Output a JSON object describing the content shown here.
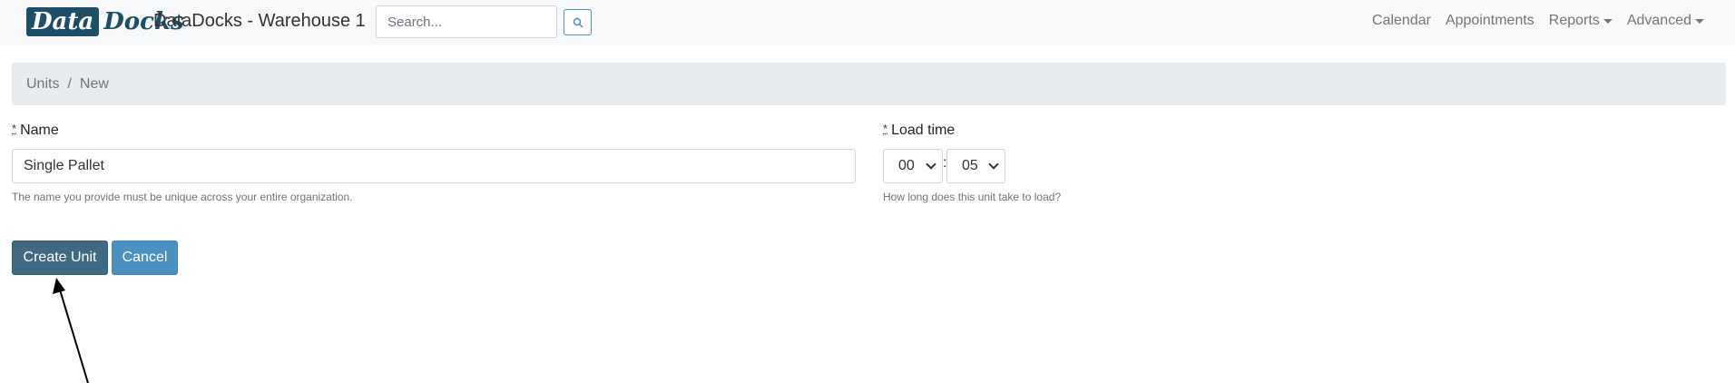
{
  "header": {
    "logo": {
      "part1": "Data",
      "part2": "Docks"
    },
    "title": "DataDocks - Warehouse 1",
    "search": {
      "placeholder": "Search...",
      "value": ""
    },
    "search_button_icon": "search-icon",
    "nav": [
      {
        "label": "Calendar",
        "dropdown": false
      },
      {
        "label": "Appointments",
        "dropdown": false
      },
      {
        "label": "Reports",
        "dropdown": true
      },
      {
        "label": "Advanced",
        "dropdown": true
      }
    ]
  },
  "breadcrumb": {
    "items": [
      "Units",
      "New"
    ],
    "separator": "/"
  },
  "form": {
    "name": {
      "required_marker": "*",
      "label": "Name",
      "value": "Single Pallet",
      "help": "The name you provide must be unique across your entire organization."
    },
    "load_time": {
      "required_marker": "*",
      "label": "Load time",
      "hours": "00",
      "separator": ":",
      "minutes": "05",
      "help": "How long does this unit take to load?"
    }
  },
  "actions": {
    "create_label": "Create Unit",
    "cancel_label": "Cancel"
  },
  "colors": {
    "brand": "#1d4e66",
    "create_button": "#3f6a82",
    "cancel_button": "#4a90c0",
    "navbar_bg": "#f8f9fa",
    "breadcrumb_bg": "#e9ecef"
  }
}
